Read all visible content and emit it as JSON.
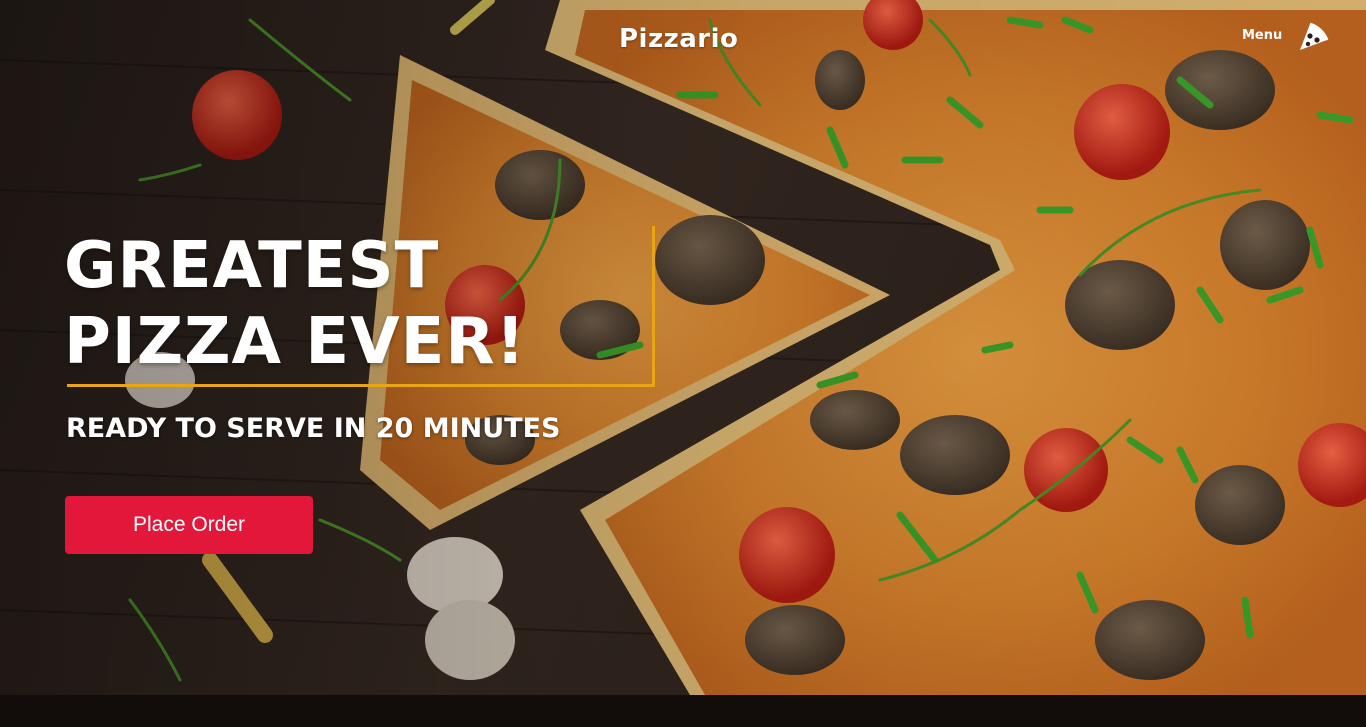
{
  "header": {
    "brand": "Pizzario",
    "menu_label": "Menu",
    "menu_icon": "pizza-slice-icon"
  },
  "hero": {
    "headline_line1": "GREATEST",
    "headline_line2": "PIZZA EVER!",
    "subheadline": "READY TO SERVE IN 20 MINUTES",
    "cta_label": "Place Order",
    "colors": {
      "cta": "#e2173a",
      "accent_border": "#e8a615",
      "text": "#ffffff",
      "footer": "#120d0b"
    }
  }
}
